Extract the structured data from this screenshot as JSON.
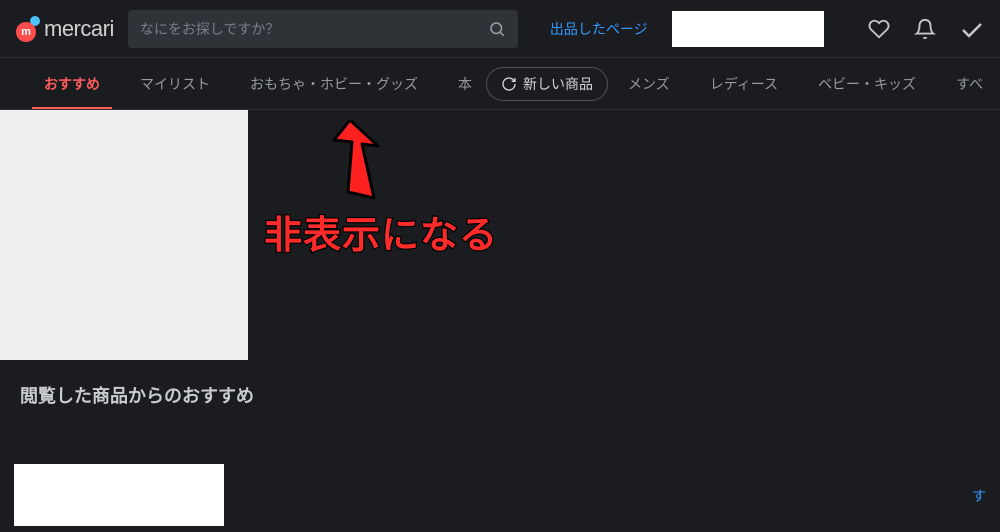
{
  "header": {
    "logo_text": "mercari",
    "logo_letter": "m",
    "search_placeholder": "なにをお探しですか？",
    "listed_page_link": "出品したページ"
  },
  "tabs": {
    "items": [
      {
        "label": "おすすめ",
        "active": true
      },
      {
        "label": "マイリスト",
        "active": false
      },
      {
        "label": "おもちゃ・ホビー・グッズ",
        "active": false
      },
      {
        "label": "本",
        "active": false
      },
      {
        "label": "メンズ",
        "active": false
      },
      {
        "label": "レディース",
        "active": false
      },
      {
        "label": "ベビー・キッズ",
        "active": false
      },
      {
        "label": "すべ",
        "active": false
      }
    ],
    "new_items_pill": "新しい商品"
  },
  "main": {
    "recommended_title": "閲覧した商品からのおすすめ",
    "bottom_right_link": "す"
  },
  "annotation": {
    "text": "非表示になる"
  }
}
